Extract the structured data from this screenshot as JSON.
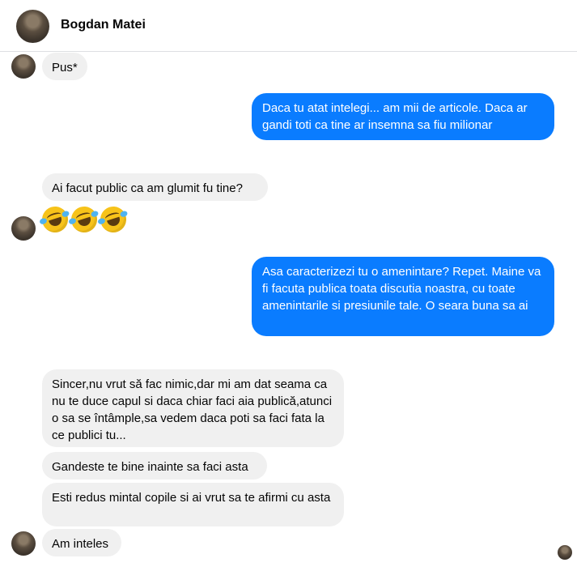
{
  "header": {
    "name": "Bogdan Matei"
  },
  "messages": [
    {
      "id": "m1",
      "side": "in",
      "text": "Pus*"
    },
    {
      "id": "m2",
      "side": "out",
      "text": "Daca tu atat intelegi... am mii de articole. Daca ar gandi toti ca tine ar insemna sa fiu milionar"
    },
    {
      "id": "m3",
      "side": "in",
      "text": "Ai facut public ca am glumit fu tine?"
    },
    {
      "id": "m4",
      "side": "in",
      "emoji": [
        "rolling-on-floor-laughing-emoji",
        "rolling-on-floor-laughing-emoji",
        "rolling-on-floor-laughing-emoji"
      ]
    },
    {
      "id": "m5",
      "side": "out",
      "text": "Asa caracterizezi tu o amenintare? Repet. Maine va fi facuta publica toata discutia noastra, cu toate amenintarile si presiunile tale. O seara buna sa ai"
    },
    {
      "id": "m6",
      "side": "in",
      "text": "Sincer,nu vrut să fac nimic,dar mi am dat seama ca nu te duce capul si daca chiar faci aia publică,atunci o sa se întâmple,sa vedem daca poti sa faci fata la ce publici tu..."
    },
    {
      "id": "m7",
      "side": "in",
      "text": "Gandeste te bine inainte sa faci asta"
    },
    {
      "id": "m8",
      "side": "in",
      "text": "Esti redus mintal copile si ai vrut sa te afirmi cu asta"
    },
    {
      "id": "m9",
      "side": "in",
      "text": "Am inteles"
    }
  ],
  "colors": {
    "outgoing": "#0a7cff",
    "incoming": "#f0f0f0"
  }
}
